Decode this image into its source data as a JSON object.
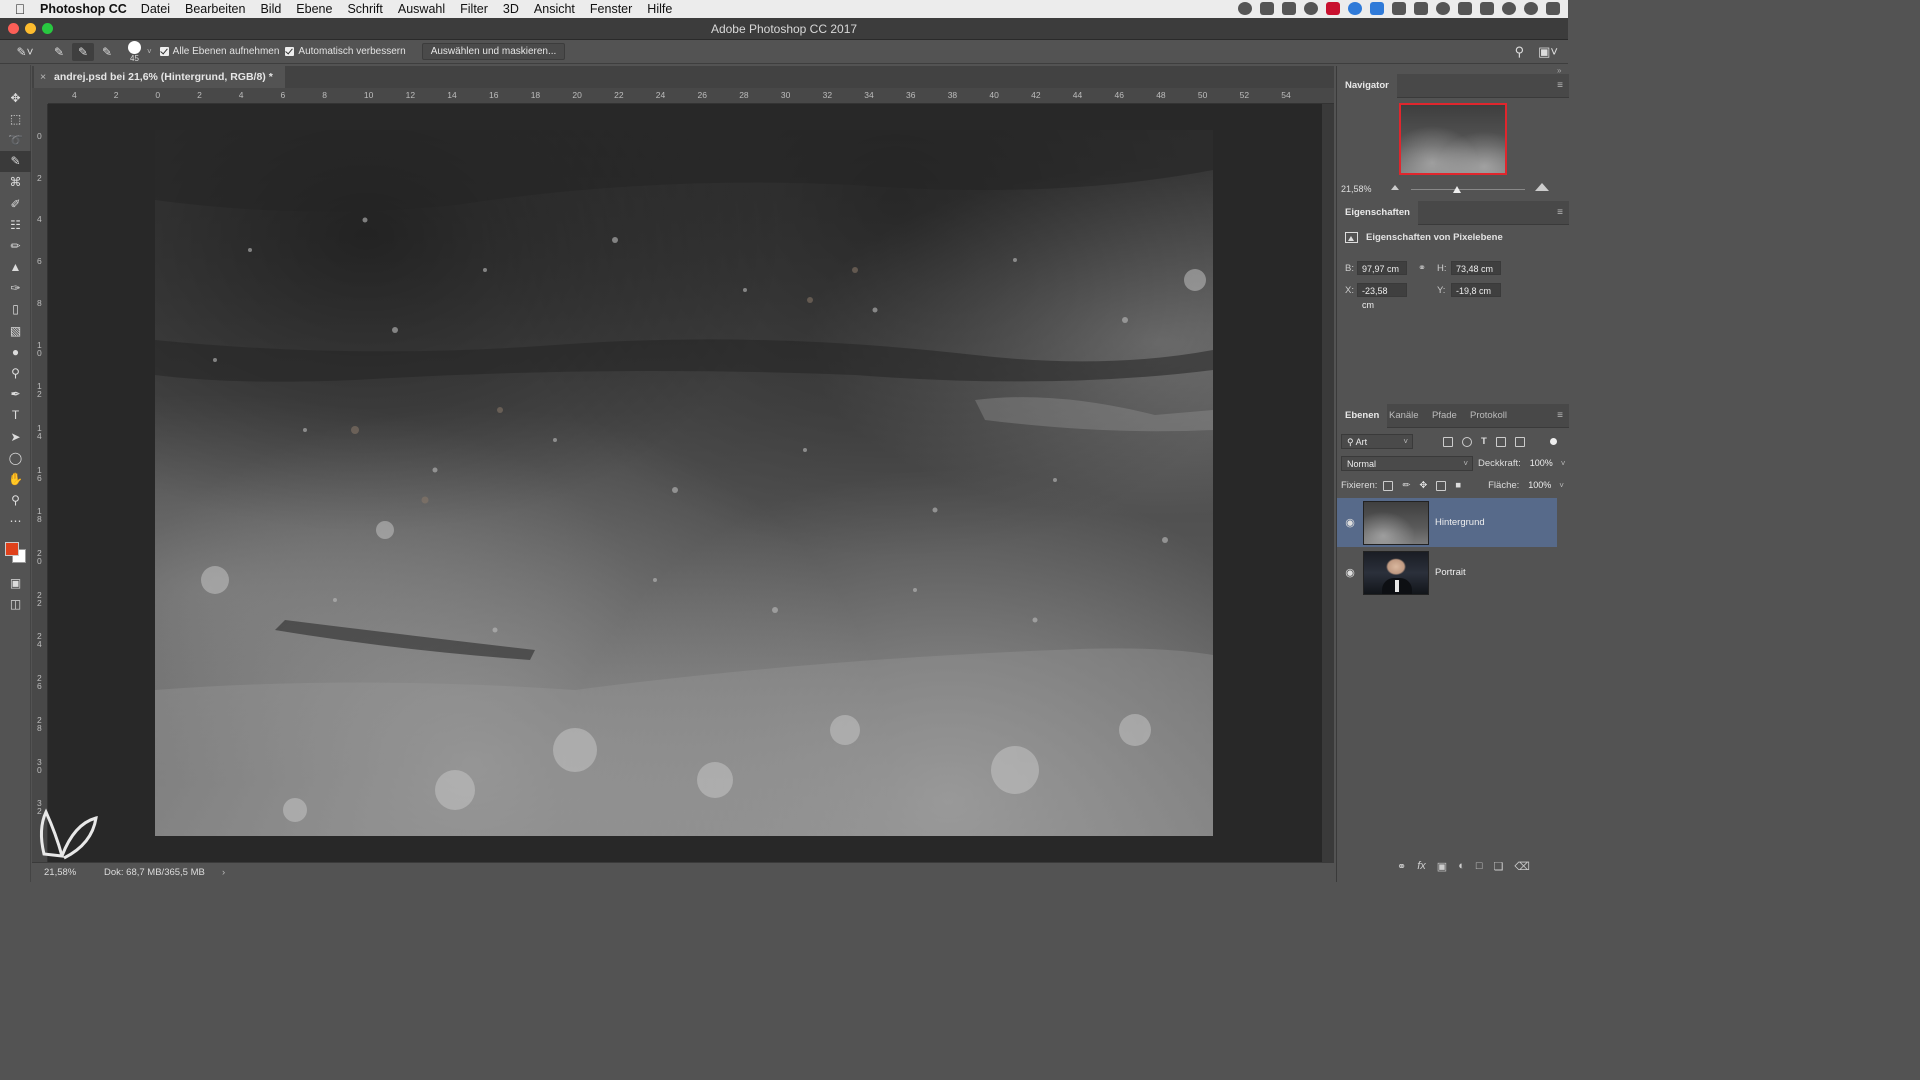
{
  "menubar": {
    "app_name": "Photoshop CC",
    "items": [
      "Datei",
      "Bearbeiten",
      "Bild",
      "Ebene",
      "Schrift",
      "Auswahl",
      "Filter",
      "3D",
      "Ansicht",
      "Fenster",
      "Hilfe"
    ]
  },
  "window": {
    "title": "Adobe Photoshop CC 2017"
  },
  "options_bar": {
    "brush_size": "45",
    "sample_all_layers_label": "Alle Ebenen aufnehmen",
    "auto_enhance_label": "Automatisch verbessern",
    "select_and_mask_label": "Auswählen und maskieren..."
  },
  "document": {
    "tab_label": "andrej.psd bei 21,6% (Hintergrund, RGB/8) *",
    "ruler_h_labels": [
      "4",
      "2",
      "0",
      "2",
      "4",
      "6",
      "8",
      "10",
      "12",
      "14",
      "16",
      "18",
      "20",
      "22",
      "24",
      "26",
      "28",
      "30",
      "32",
      "34",
      "36",
      "38",
      "40",
      "42",
      "44",
      "46",
      "48",
      "50",
      "52",
      "54"
    ],
    "ruler_v_labels": [
      "0",
      "2",
      "4",
      "6",
      "8",
      "1\n0",
      "1\n2",
      "1\n4",
      "1\n6",
      "1\n8",
      "2\n0",
      "2\n2",
      "2\n4",
      "2\n6",
      "2\n8",
      "3\n0",
      "3\n2"
    ]
  },
  "status": {
    "zoom": "21,58%",
    "doc_info": "Dok: 68,7 MB/365,5 MB",
    "arrow": "›"
  },
  "navigator": {
    "title": "Navigator",
    "zoom": "21,58%",
    "zoom_fraction": 0.4
  },
  "properties": {
    "title": "Eigenschaften",
    "section_label": "Eigenschaften von Pixelebene",
    "w_label": "B:",
    "w_value": "97,97 cm",
    "h_label": "H:",
    "h_value": "73,48 cm",
    "x_label": "X:",
    "x_value": "-23,58 cm",
    "y_label": "Y:",
    "y_value": "-19,8 cm"
  },
  "layers_panel": {
    "tabs": [
      "Ebenen",
      "Kanäle",
      "Pfade",
      "Protokoll"
    ],
    "filter_kind": "Art",
    "blend_mode": "Normal",
    "opacity_label": "Deckkraft:",
    "opacity_value": "100%",
    "lock_label": "Fixieren:",
    "fill_label": "Fläche:",
    "fill_value": "100%",
    "layers": [
      {
        "name": "Hintergrund",
        "selected": true
      },
      {
        "name": "Portrait",
        "selected": false
      }
    ]
  },
  "colors": {
    "foreground": "#e0421c",
    "background": "#ffffff",
    "navigator_frame": "#e0262d",
    "selected_layer": "#576a8a"
  },
  "tools": [
    "move-icon",
    "marquee-icon",
    "lasso-icon",
    "quick-selection-icon",
    "crop-icon",
    "eyedropper-icon",
    "healing-brush-icon",
    "brush-icon",
    "clone-stamp-icon",
    "history-brush-icon",
    "eraser-icon",
    "gradient-icon",
    "blur-icon",
    "dodge-icon",
    "pen-icon",
    "type-icon",
    "path-selection-icon",
    "ellipse-icon",
    "hand-icon",
    "zoom-icon",
    "more-tools-icon"
  ]
}
